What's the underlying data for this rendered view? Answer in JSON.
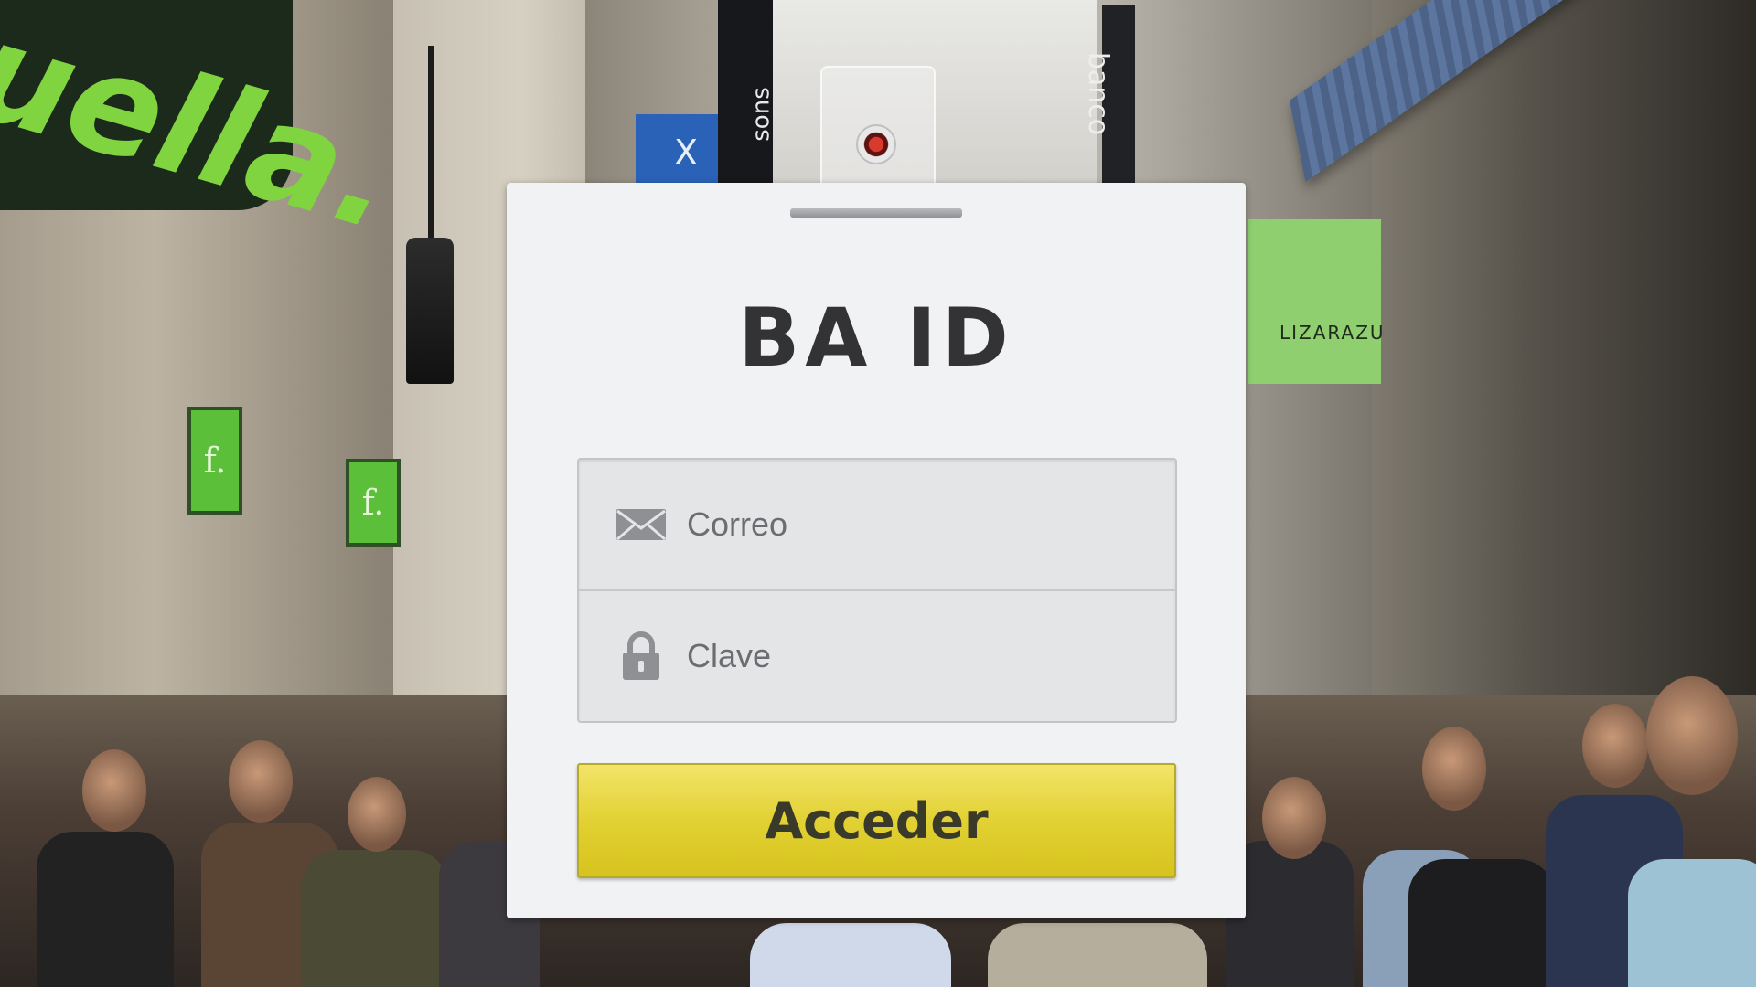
{
  "login": {
    "title": "BA ID",
    "email": {
      "placeholder": "Correo",
      "icon": "envelope-icon"
    },
    "password": {
      "placeholder": "Clave",
      "icon": "lock-icon"
    },
    "submit_label": "Acceder"
  },
  "background": {
    "signs": {
      "store_logo": "uella.",
      "f_sign": "f.",
      "blue_sign": "X",
      "sons": "sons",
      "banco": "banco",
      "lizarazu": "LIZARAZU"
    }
  },
  "colors": {
    "card_bg": "#f1f2f4",
    "title": "#333336",
    "button_yellow": "#e2d133",
    "field_bg": "#e4e5e7"
  }
}
